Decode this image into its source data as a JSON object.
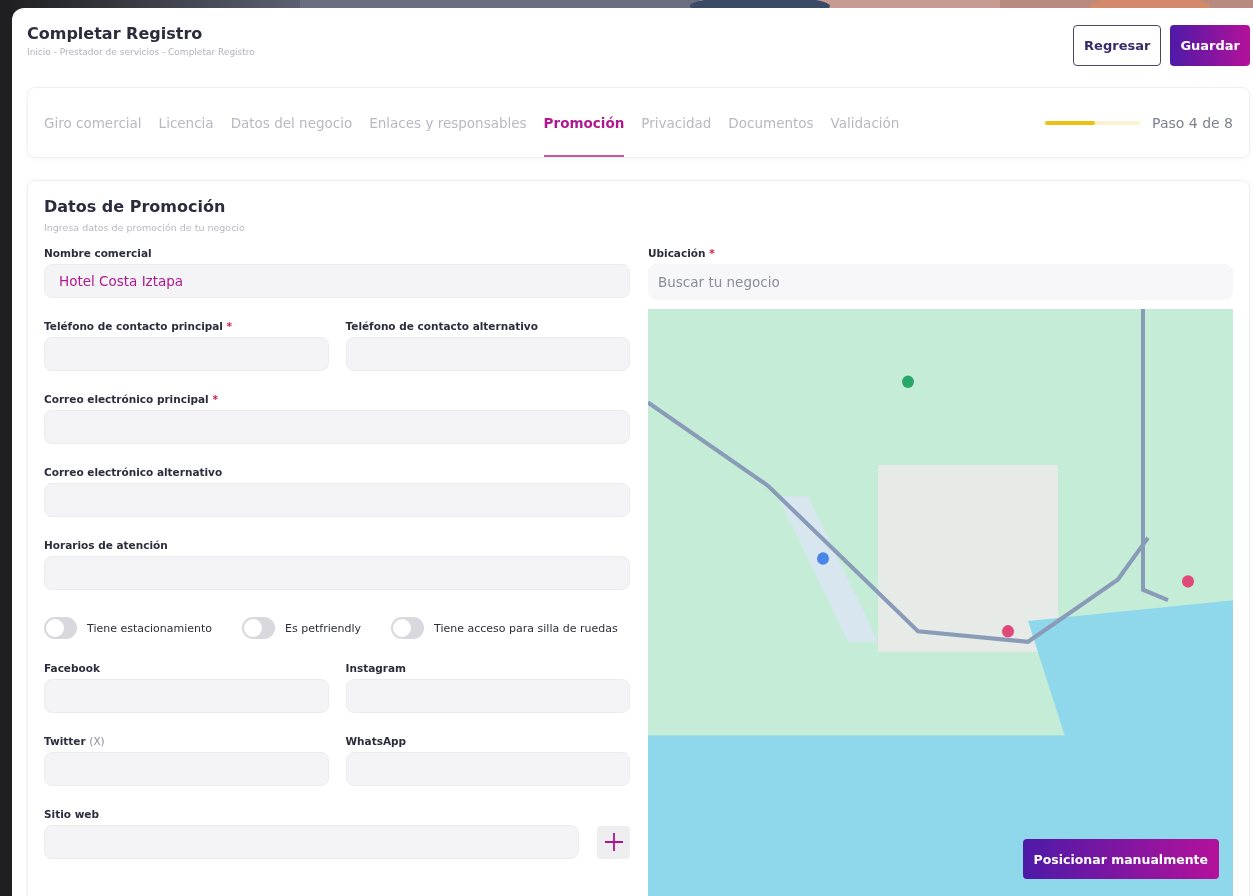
{
  "header": {
    "title": "Completar Registro",
    "breadcrumb": "Inicio - Prestador de servicios - Completar Registro",
    "buttons": [
      {
        "label": "Regresar",
        "kind": "outline"
      },
      {
        "label": "Guardar",
        "kind": "primary"
      }
    ]
  },
  "steps": {
    "tabs": [
      {
        "label": "Giro comercial",
        "selected": false
      },
      {
        "label": "Licencia",
        "selected": false
      },
      {
        "label": "Datos del negocio",
        "selected": false
      },
      {
        "label": "Enlaces y responsables",
        "selected": false
      },
      {
        "label": "Promoción",
        "selected": true
      },
      {
        "label": "Privacidad",
        "selected": false
      },
      {
        "label": "Documentos",
        "selected": false
      },
      {
        "label": "Validación",
        "selected": false
      }
    ],
    "progress": {
      "level": 0.53,
      "label": "Paso 4 de 8"
    }
  },
  "section": {
    "title": "Datos de Promoción",
    "subtitle": "Ingresa datos de promoción de tu negocio",
    "rows": [
      {
        "kind": "fields",
        "fields": [
          {
            "label": "Nombre comercial",
            "value": "Hotel Costa Iztapa"
          }
        ]
      },
      {
        "kind": "fields",
        "fields": [
          {
            "label": "Teléfono de contacto principal",
            "required_mark": "*"
          },
          {
            "label": "Teléfono de contacto alternativo"
          }
        ]
      },
      {
        "kind": "fields",
        "fields": [
          {
            "label": "Correo electrónico principal",
            "required_mark": "*"
          }
        ]
      },
      {
        "kind": "fields",
        "fields": [
          {
            "label": "Correo electrónico alternativo"
          }
        ]
      },
      {
        "kind": "fields",
        "fields": [
          {
            "label": "Horarios de atención"
          }
        ]
      },
      {
        "kind": "toggles",
        "toggles": [
          {
            "label": "Tiene estacionamiento",
            "on": false
          },
          {
            "label": "Es petfriendly",
            "on": false
          },
          {
            "label": "Tiene acceso para silla de ruedas",
            "on": false
          }
        ]
      },
      {
        "kind": "fields",
        "fields": [
          {
            "label": "Facebook"
          },
          {
            "label": "Instagram"
          }
        ]
      },
      {
        "kind": "fields",
        "fields": [
          {
            "label": "Twitter",
            "label_note": "(X)"
          },
          {
            "label": "WhatsApp"
          }
        ]
      },
      {
        "kind": "add",
        "fields": [
          {
            "label": "Sitio web"
          }
        ]
      }
    ],
    "location": {
      "label": "Ubicación",
      "required_mark": "*",
      "placeholder": "Buscar tu negocio",
      "map": {
        "kind": "picture",
        "button": "Posicionar manualmente"
      }
    }
  }
}
